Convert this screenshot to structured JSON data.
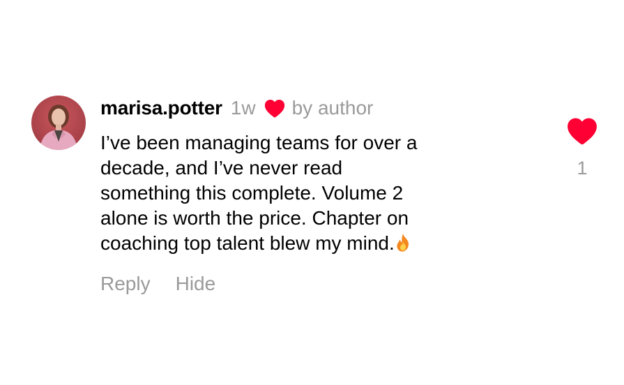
{
  "comment": {
    "username": "marisa.potter",
    "timestamp": "1w",
    "author_like_label": "by author",
    "text": "I’ve been managing teams for over a\ndecade, and I’ve never read\nsomething this complete. Volume 2\nalone is worth the price. Chapter on\ncoaching top talent blew my mind.",
    "trailing_emoji_icon": "fire-icon",
    "actions": {
      "reply_label": "Reply",
      "hide_label": "Hide"
    }
  },
  "likes": {
    "count": "1",
    "icon": "heart-icon"
  },
  "colors": {
    "heart": "#fe0033",
    "secondary_text": "#9a9a9a",
    "primary_text": "#000000",
    "avatar_bg": "#b8454f"
  }
}
